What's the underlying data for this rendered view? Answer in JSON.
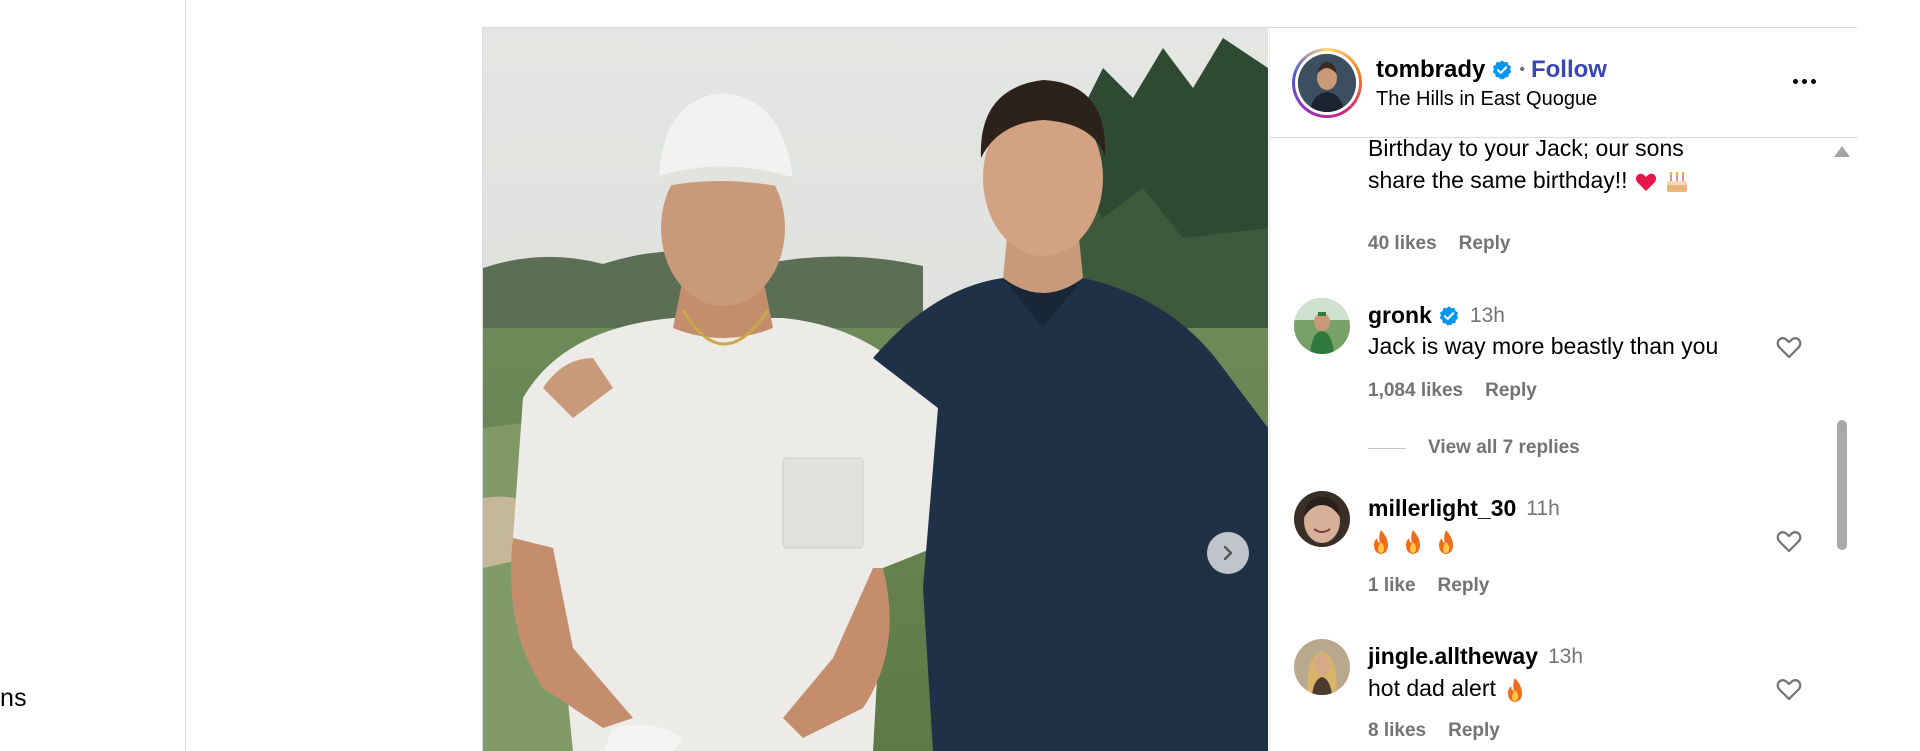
{
  "sidebar": {
    "partial_label": "ns"
  },
  "post": {
    "author": {
      "username": "tombrady",
      "verified": true,
      "follow_label": "Follow",
      "separator": "•",
      "location": "The Hills in East Quogue"
    },
    "more_icon": "more-options-icon",
    "carousel_next_icon": "chevron-right-icon"
  },
  "comments": [
    {
      "partial_text_line1": "Birthday to your Jack; our sons",
      "text_line2": "share the same birthday!!",
      "emojis": [
        "red-heart",
        "birthday-cake"
      ],
      "likes": "40 likes",
      "reply_label": "Reply"
    },
    {
      "username": "gronk",
      "verified": true,
      "time": "13h",
      "text": "Jack is way more beastly than you",
      "likes": "1,084 likes",
      "reply_label": "Reply",
      "view_replies": "View all 7 replies"
    },
    {
      "username": "millerlight_30",
      "time": "11h",
      "text": "",
      "emojis": [
        "fire",
        "fire",
        "fire"
      ],
      "likes": "1 like",
      "reply_label": "Reply"
    },
    {
      "username": "jingle.alltheway",
      "time": "13h",
      "text": "hot dad alert",
      "emojis": [
        "fire"
      ],
      "likes": "8 likes",
      "reply_label": "Reply"
    }
  ],
  "colors": {
    "follow": "#3847b8",
    "verified": "#0095f6",
    "secondary_text": "#737373",
    "border": "#dbdbdb"
  }
}
